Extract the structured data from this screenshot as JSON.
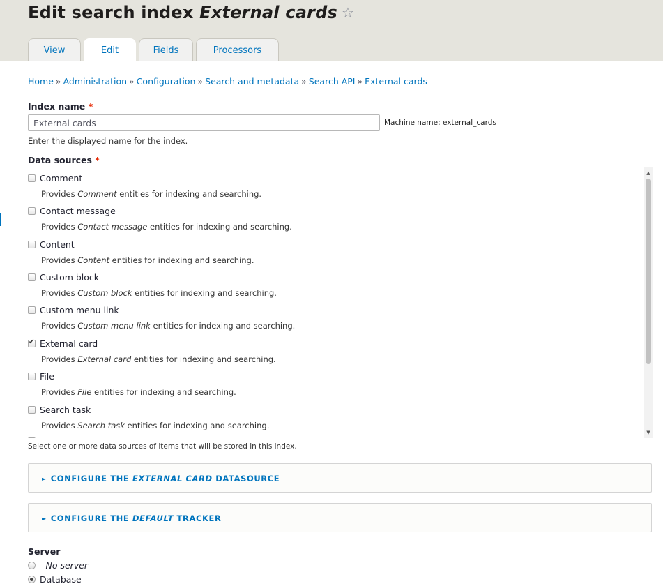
{
  "header": {
    "title_prefix": "Edit search index ",
    "title_name": "External cards",
    "star_icon": "☆"
  },
  "tabs": [
    {
      "label": "View",
      "active": false
    },
    {
      "label": "Edit",
      "active": true
    },
    {
      "label": "Fields",
      "active": false
    },
    {
      "label": "Processors",
      "active": false
    }
  ],
  "breadcrumb": {
    "separator": "»",
    "items": [
      "Home",
      "Administration",
      "Configuration",
      "Search and metadata",
      "Search API",
      "External cards"
    ]
  },
  "index_name": {
    "label": "Index name",
    "required_mark": "*",
    "value": "External cards",
    "machine_name": "Machine name: external_cards",
    "description": "Enter the displayed name for the index."
  },
  "data_sources": {
    "label": "Data sources",
    "required_mark": "*",
    "desc_prefix": "Provides ",
    "desc_suffix": " entities for indexing and searching.",
    "items": [
      {
        "label": "Comment",
        "checked": false
      },
      {
        "label": "Contact message",
        "checked": false
      },
      {
        "label": "Content",
        "checked": false
      },
      {
        "label": "Custom block",
        "checked": false
      },
      {
        "label": "Custom menu link",
        "checked": false
      },
      {
        "label": "External card",
        "checked": true
      },
      {
        "label": "File",
        "checked": false
      },
      {
        "label": "Search task",
        "checked": false
      }
    ],
    "help": "Select one or more data sources of items that will be stored in this index."
  },
  "configure_datasource": {
    "caret": "►",
    "prefix": "Configure the ",
    "name": "External card",
    "suffix": " datasource"
  },
  "configure_tracker": {
    "caret": "►",
    "prefix": "Configure the ",
    "name": "Default",
    "suffix": " tracker"
  },
  "server": {
    "label": "Server",
    "options": [
      {
        "label": "- No server -",
        "selected": false
      },
      {
        "label": "Database",
        "selected": true
      }
    ]
  },
  "icons": {
    "checkmark": "checkbox-check-icon",
    "scroll_up": "▲",
    "scroll_down": "▼"
  },
  "colors": {
    "link": "#0074bd",
    "required": "#e62600",
    "header_bg": "#e5e4dd"
  }
}
